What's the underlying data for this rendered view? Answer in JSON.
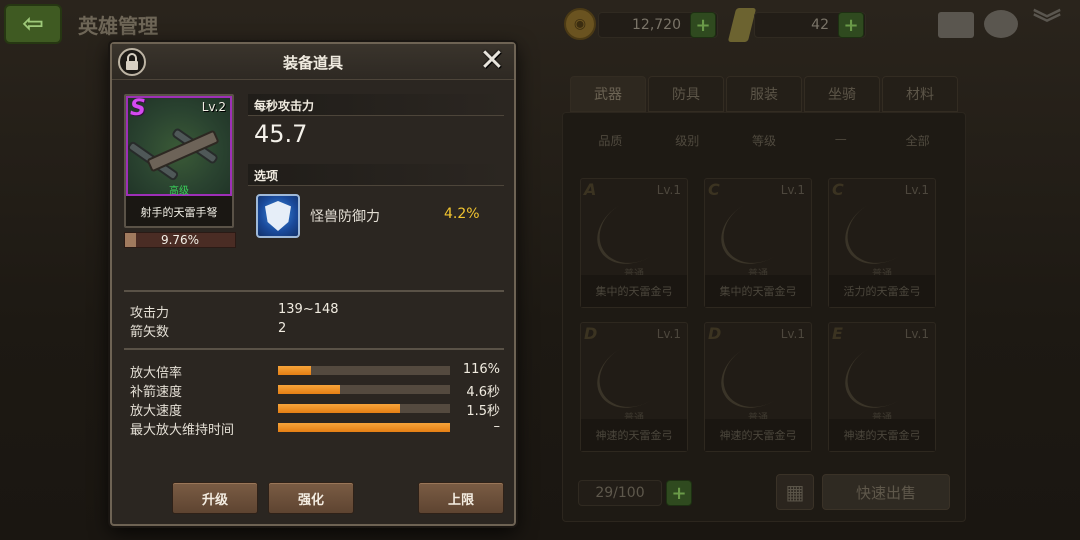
{
  "screen": {
    "title": "英雄管理",
    "back_icon": "back-arrow-icon"
  },
  "resources": {
    "gold": "12,720",
    "gems": "42"
  },
  "inventory": {
    "tabs": [
      "武器",
      "防具",
      "服装",
      "坐骑",
      "材料"
    ],
    "active_tab": "武器",
    "filters": [
      "品质",
      "级别",
      "等级",
      "—",
      "全部"
    ],
    "items": [
      {
        "grade": "A",
        "level": "Lv.1",
        "quality": "普通",
        "name": "集中的天雷金弓"
      },
      {
        "grade": "C",
        "level": "Lv.1",
        "quality": "普通",
        "name": "集中的天雷金弓"
      },
      {
        "grade": "C",
        "level": "Lv.1",
        "quality": "普通",
        "name": "活力的天雷金弓"
      },
      {
        "grade": "D",
        "level": "Lv.1",
        "quality": "普通",
        "name": "神速的天雷金弓"
      },
      {
        "grade": "D",
        "level": "Lv.1",
        "quality": "普通",
        "name": "神速的天雷金弓"
      },
      {
        "grade": "E",
        "level": "Lv.1",
        "quality": "普通",
        "name": "神速的天雷金弓"
      }
    ],
    "count": "29/100",
    "quick_sell_label": "快速出售"
  },
  "modal": {
    "title": "装备道具",
    "item": {
      "grade": "S",
      "level": "Lv.2",
      "quality": "高级",
      "name": "射手的天雷手弩",
      "xp_text": "9.76%",
      "xp_fraction": 0.0976
    },
    "dps": {
      "label": "每秒攻击力",
      "value": "45.7"
    },
    "option": {
      "header": "选项",
      "label": "怪兽防御力",
      "value": "4.2%",
      "icon": "dragon-shield-icon"
    },
    "stats": [
      {
        "label": "攻击力",
        "value": "139~148"
      },
      {
        "label": "箭矢数",
        "value": "2"
      }
    ],
    "bars": [
      {
        "label": "放大倍率",
        "value": "116%",
        "fraction": 0.19
      },
      {
        "label": "补箭速度",
        "value": "4.6秒",
        "fraction": 0.36
      },
      {
        "label": "放大速度",
        "value": "1.5秒",
        "fraction": 0.71
      },
      {
        "label": "最大放大维持时间",
        "value": "–",
        "fraction": 1.0
      }
    ],
    "buttons": {
      "upgrade": "升级",
      "enhance": "强化",
      "limit": "上限"
    }
  },
  "colors": {
    "grade_s": "#d44af0",
    "quality_high": "#39d05a",
    "option_value": "#f2c530",
    "bar_fill": "#f7a43a"
  }
}
